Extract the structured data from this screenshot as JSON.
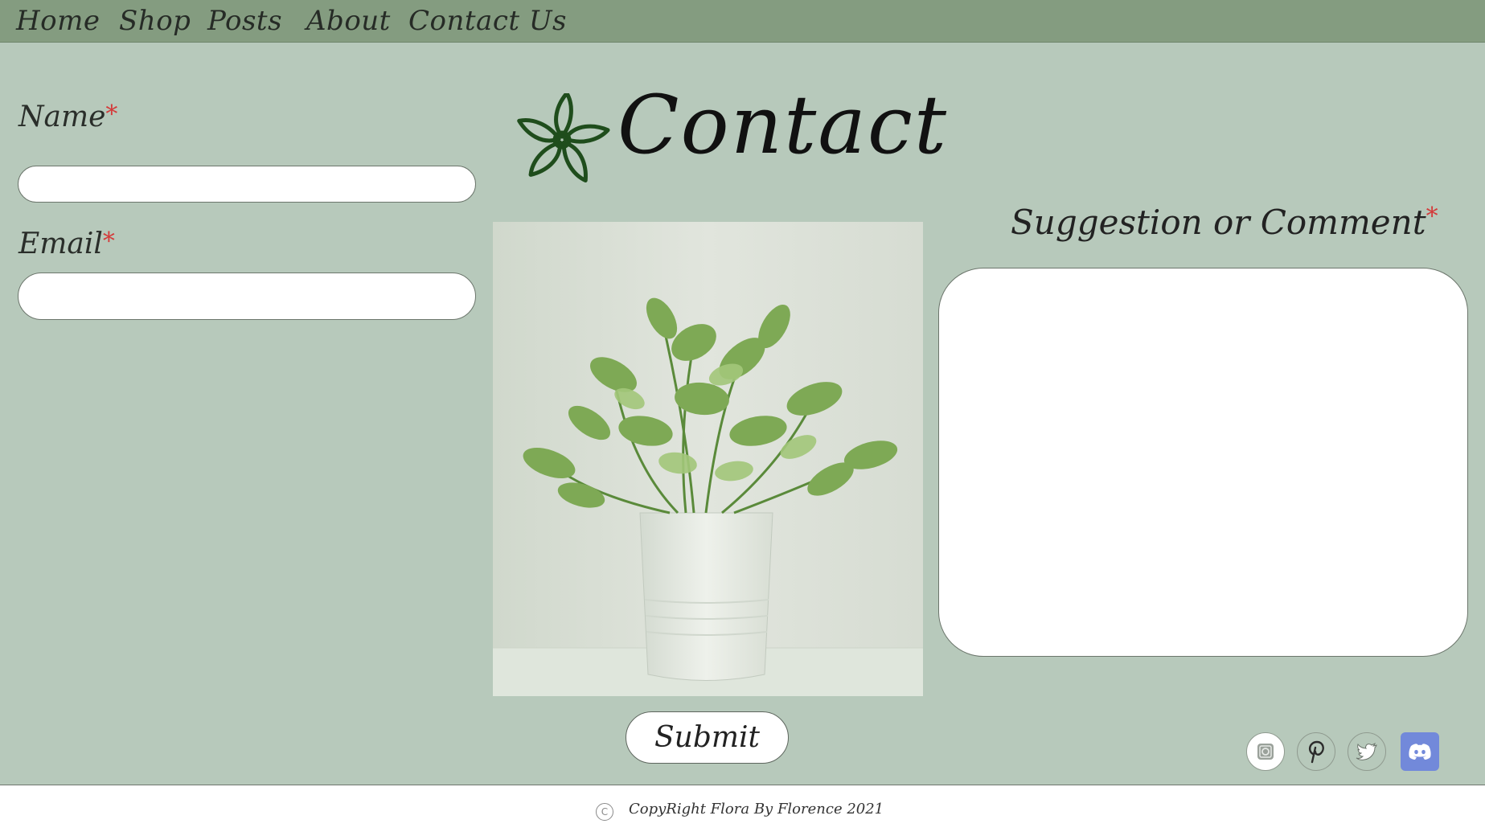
{
  "nav": {
    "items": [
      {
        "label": "Home"
      },
      {
        "label": "Shop"
      },
      {
        "label": "Posts"
      },
      {
        "label": "About"
      },
      {
        "label": "Contact Us"
      }
    ]
  },
  "form": {
    "name_label": "Name",
    "email_label": "Email",
    "comment_label": "Suggestion or Comment",
    "required_mark": "*",
    "name_value": "",
    "email_value": "",
    "comment_value": "",
    "submit_label": "Submit"
  },
  "hero": {
    "title": "Contact",
    "logo_icon": "flower-outline-icon",
    "logo_color": "#1f4d1c"
  },
  "social": [
    {
      "icon": "instagram-icon"
    },
    {
      "icon": "pinterest-icon"
    },
    {
      "icon": "twitter-icon"
    },
    {
      "icon": "discord-icon",
      "color": "#7289da"
    }
  ],
  "footer": {
    "copyright_symbol": "C",
    "copyright_text": "CopyRight Flora By Florence 2021"
  },
  "colors": {
    "page_background": "#b7c9bb",
    "nav_background": "#849c80",
    "required": "#d43a3a"
  }
}
